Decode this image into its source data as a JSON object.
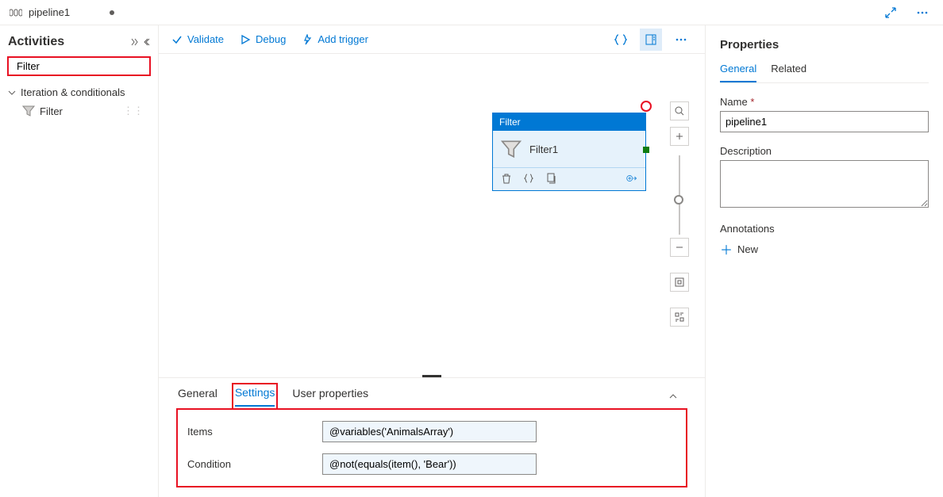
{
  "topbar": {
    "title": "pipeline1"
  },
  "sidebar": {
    "title": "Activities",
    "search_value": "Filter",
    "category": "Iteration & conditionals",
    "activity": "Filter"
  },
  "actionbar": {
    "validate": "Validate",
    "debug": "Debug",
    "add_trigger": "Add trigger"
  },
  "node": {
    "header": "Filter",
    "name": "Filter1"
  },
  "bottom": {
    "tabs": {
      "general": "General",
      "settings": "Settings",
      "user_props": "User properties"
    },
    "items_label": "Items",
    "items_value": "@variables('AnimalsArray')",
    "condition_label": "Condition",
    "condition_value": "@not(equals(item(), 'Bear'))"
  },
  "properties": {
    "title": "Properties",
    "tabs": {
      "general": "General",
      "related": "Related"
    },
    "name_label": "Name",
    "name_value": "pipeline1",
    "description_label": "Description",
    "annotations_label": "Annotations",
    "new_label": "New"
  }
}
